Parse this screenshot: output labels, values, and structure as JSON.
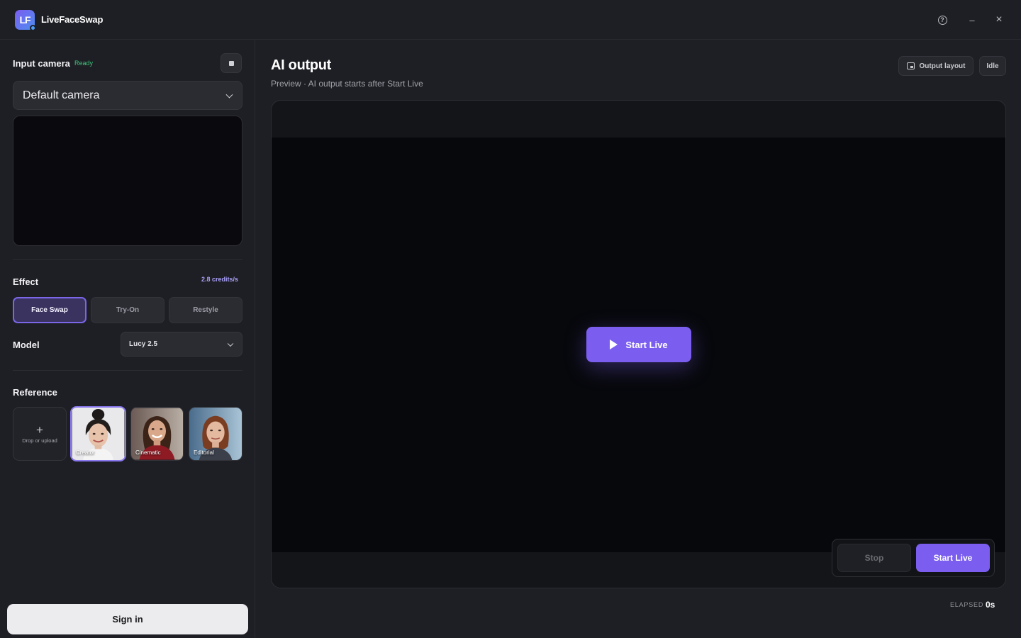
{
  "app": {
    "logo_text": "LF",
    "title": "LiveFaceSwap"
  },
  "window": {
    "help_icon": "question-circle-icon",
    "minimize_label": "–",
    "close_label": "×"
  },
  "sidebar": {
    "input_camera": {
      "title": "Input camera",
      "status": "Ready",
      "status_color": "#3ec37a",
      "camera_value": "Default camera"
    },
    "effect": {
      "title": "Effect",
      "credits": "2.8 credits/s",
      "options": [
        "Face Swap",
        "Try-On",
        "Restyle"
      ],
      "selected": "Face Swap"
    },
    "model": {
      "title": "Model",
      "value": "Lucy 2.5"
    },
    "reference": {
      "title": "Reference",
      "upload_label": "Drop or upload",
      "items": [
        {
          "label": "Creator",
          "selected": true
        },
        {
          "label": "Cinematic",
          "selected": false
        },
        {
          "label": "Editorial",
          "selected": false
        }
      ]
    },
    "signin_label": "Sign in"
  },
  "main": {
    "title": "AI output",
    "subtitle": "Preview · AI output starts after Start Live",
    "output_layout_label": "Output layout",
    "status_badge": "Idle",
    "center_start_label": "Start Live",
    "stop_label": "Stop",
    "start_label": "Start Live",
    "elapsed_label": "ELAPSED",
    "elapsed_value": "0s"
  },
  "colors": {
    "accent": "#7b5ef0",
    "background": "#1e1f24",
    "credits": "#a99ff7"
  }
}
